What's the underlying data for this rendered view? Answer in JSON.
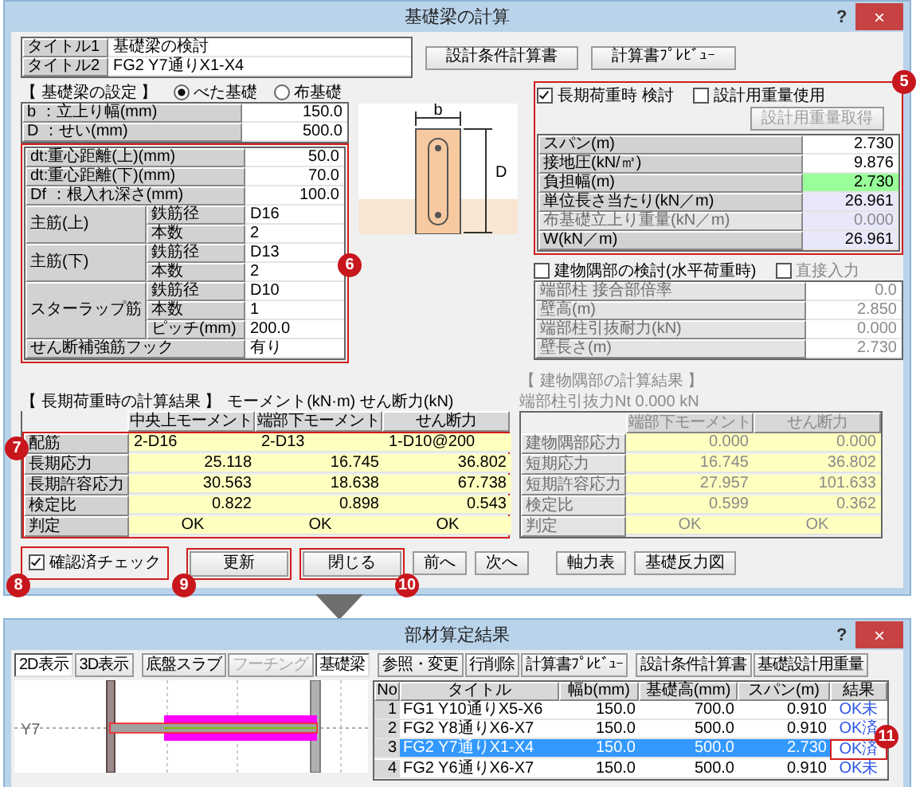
{
  "window": {
    "title": "基礎梁の計算",
    "help": "?",
    "close": "×"
  },
  "titles": [
    {
      "label": "タイトル1",
      "value": "基礎梁の検討"
    },
    {
      "label": "タイトル2",
      "value": "FG2 Y7通りX1-X4"
    }
  ],
  "top_buttons": [
    "設計条件計算書",
    "計算書ﾌﾟﾚﾋﾞｭｰ"
  ],
  "settings": {
    "heading": "【 基礎梁の設定 】",
    "callout": "6",
    "foundation_types": [
      {
        "label": "べた基礎",
        "selected": true
      },
      {
        "label": "布基礎",
        "selected": false
      }
    ],
    "rows": [
      {
        "kind": "single",
        "label": "b ：立上り幅(mm)",
        "value": "150.0"
      },
      {
        "kind": "single",
        "label": "D ：せい(mm)",
        "value": "500.0"
      }
    ],
    "callout_rows": [
      {
        "kind": "single",
        "label": "dt:重心距離(上)(mm)",
        "value": "50.0"
      },
      {
        "kind": "single",
        "label": "dt:重心距離(下)(mm)",
        "value": "70.0"
      },
      {
        "kind": "single",
        "label": "Df ：根入れ深さ(mm)",
        "value": "100.0"
      },
      {
        "kind": "group",
        "label": "主筋(上)",
        "sub": [
          {
            "label": "鉄筋径",
            "value": "D16"
          },
          {
            "label": "本数",
            "value": "2"
          }
        ]
      },
      {
        "kind": "group",
        "label": "主筋(下)",
        "sub": [
          {
            "label": "鉄筋径",
            "value": "D13"
          },
          {
            "label": "本数",
            "value": "2"
          }
        ]
      },
      {
        "kind": "group",
        "label": "スターラップ筋",
        "sub": [
          {
            "label": "鉄筋径",
            "value": "D10"
          },
          {
            "label": "本数",
            "value": "1"
          },
          {
            "label": "ピッチ(mm)",
            "value": "200.0"
          }
        ]
      },
      {
        "kind": "single",
        "label": "せん断補強筋フック",
        "value": "有り"
      }
    ]
  },
  "diagram": {
    "width_label": "b",
    "height_label": "D"
  },
  "long_term": {
    "callout": "5",
    "check": {
      "label": "長期荷重時 検討",
      "checked": true
    },
    "use_weight": {
      "label": "設計用重量使用",
      "checked": false
    },
    "fetch_button": {
      "label": "設計用重量取得",
      "disabled": true
    },
    "rows": [
      {
        "label": "スパン(m)",
        "value": "2.730",
        "color": "#ffffff",
        "disabled": false
      },
      {
        "label": "接地圧(kN/㎡)",
        "value": "9.876",
        "color": "#ffffff",
        "disabled": false
      },
      {
        "label": "負担幅(m)",
        "value": "2.730",
        "color": "#99ff99",
        "disabled": false
      },
      {
        "label": "単位長さ当たり(kN／m)",
        "value": "26.961",
        "color": "#e8e8fa",
        "disabled": false
      },
      {
        "label": "布基礎立上り重量(kN／m)",
        "value": "0.000",
        "color": "#e8e8fa",
        "disabled": true
      },
      {
        "label": "W(kN／m)",
        "value": "26.961",
        "color": "#e8e8fa",
        "disabled": false
      }
    ]
  },
  "corner": {
    "check": {
      "label": "建物隅部の検討(水平荷重時)",
      "checked": false
    },
    "direct_input": {
      "label": "直接入力",
      "checked": false,
      "disabled": true
    },
    "disabled": true,
    "rows": [
      {
        "label": "端部柱 接合部倍率",
        "value": "0.0"
      },
      {
        "label": "壁高(m)",
        "value": "2.850"
      },
      {
        "label": "端部柱引抜耐力(kN)",
        "value": "0.000"
      },
      {
        "label": "壁長さ(m)",
        "value": "2.730"
      }
    ]
  },
  "long_result": {
    "callout": "7",
    "heading": "【 長期荷重時の計算結果 】",
    "units": "モーメント(kN·m) せん断力(kN)",
    "disabled": false,
    "columns": [
      "中央上モーメント",
      "端部下モーメント",
      "せん断力"
    ],
    "rows": [
      {
        "kind": "text",
        "label": "配筋",
        "values": [
          "2-D16",
          "2-D13",
          "1-D10@200"
        ]
      },
      {
        "kind": "number",
        "label": "長期応力",
        "values": [
          "25.118",
          "16.745",
          "36.802"
        ]
      },
      {
        "kind": "number",
        "label": "長期許容応力",
        "values": [
          "30.563",
          "18.638",
          "67.738"
        ]
      },
      {
        "kind": "number",
        "label": "検定比",
        "values": [
          "0.822",
          "0.898",
          "0.543"
        ]
      },
      {
        "kind": "verdict",
        "label": "判定",
        "values": [
          "OK",
          "OK",
          "OK"
        ]
      }
    ]
  },
  "corner_result": {
    "heading": "【 建物隅部の計算結果 】",
    "units": "端部柱引抜力Nt 0.000 kN",
    "disabled": true,
    "columns": [
      "端部下モーメント",
      "せん断力"
    ],
    "rows": [
      {
        "kind": "number",
        "label": "建物隅部応力",
        "values": [
          "0.000",
          "0.000"
        ]
      },
      {
        "kind": "number",
        "label": "短期応力",
        "values": [
          "16.745",
          "36.802"
        ]
      },
      {
        "kind": "number",
        "label": "短期許容応力",
        "values": [
          "27.957",
          "101.633"
        ]
      },
      {
        "kind": "number",
        "label": "検定比",
        "values": [
          "0.599",
          "0.362"
        ]
      },
      {
        "kind": "verdict",
        "label": "判定",
        "values": [
          "OK",
          "OK"
        ]
      }
    ]
  },
  "confirm": {
    "label": "確認済チェック",
    "checked": true,
    "callout": "8"
  },
  "buttons": [
    {
      "label": "更新",
      "callout": "9"
    },
    {
      "label": "閉じる",
      "callout": "10"
    },
    {
      "label": "前へ"
    },
    {
      "label": "次へ"
    },
    {
      "label": "軸力表"
    },
    {
      "label": "基礎反力図"
    }
  ],
  "results_window": {
    "title": "部材算定結果",
    "help": "?",
    "close": "×",
    "toolbar": [
      {
        "label": "2D表示",
        "selected": true,
        "disabled": false
      },
      {
        "label": "3D表示",
        "selected": false,
        "disabled": false
      },
      {
        "label": "底盤スラブ",
        "selected": false,
        "disabled": false
      },
      {
        "label": "フーチング",
        "selected": false,
        "disabled": true
      },
      {
        "label": "基礎梁",
        "selected": true,
        "disabled": false
      },
      {
        "label": "参照・変更",
        "selected": false,
        "disabled": false
      },
      {
        "label": "行削除",
        "selected": false,
        "disabled": false
      },
      {
        "label": "計算書ﾌﾟﾚﾋﾞｭｰ",
        "selected": false,
        "disabled": false
      },
      {
        "label": "設計条件計算書",
        "selected": false,
        "disabled": false
      },
      {
        "label": "基礎設計用重量",
        "selected": false,
        "disabled": false
      }
    ],
    "plan": {
      "axis_label": "Y7"
    },
    "table": {
      "columns": [
        "No",
        "タイトル",
        "幅b(mm)",
        "基礎高(mm)",
        "スパン(m)",
        "結果"
      ],
      "rows": [
        {
          "cells": [
            "1",
            "FG1 Y10通りX5-X6",
            "150.0",
            "700.0",
            "0.910"
          ],
          "result": "OK未",
          "selected": false
        },
        {
          "cells": [
            "2",
            "FG2 Y8通りX6-X7",
            "150.0",
            "500.0",
            "0.910"
          ],
          "result": "OK済",
          "selected": false
        },
        {
          "cells": [
            "3",
            "FG2 Y7通りX1-X4",
            "150.0",
            "500.0",
            "2.730"
          ],
          "result": "OK済",
          "selected": true,
          "callout": "11"
        },
        {
          "cells": [
            "4",
            "FG2 Y6通りX6-X7",
            "150.0",
            "500.0",
            "0.910"
          ],
          "result": "OK未",
          "selected": false
        }
      ]
    }
  }
}
